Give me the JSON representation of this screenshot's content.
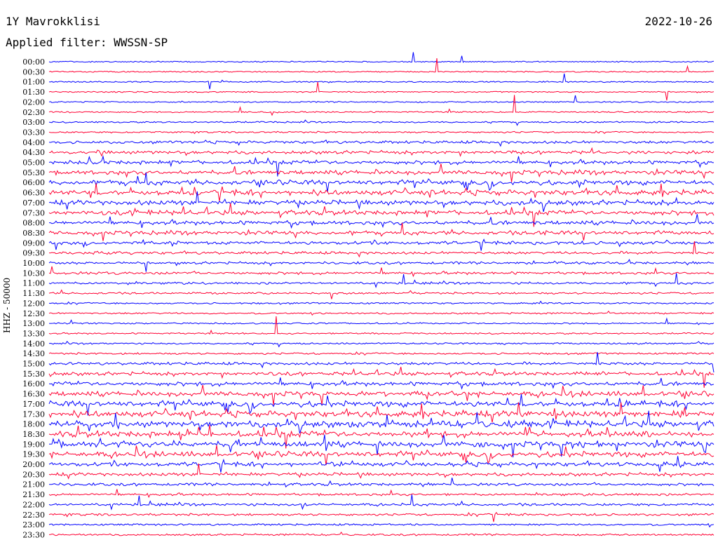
{
  "header": {
    "station": "1Y Mavrokklisi",
    "filter": "Applied filter: WWSSN-SP",
    "date": "2022-10-26"
  },
  "chart_data": {
    "type": "line",
    "title": "1Y Mavrokklisi",
    "subtitle": "Applied filter: WWSSN-SP",
    "date": "2022-10-26",
    "ylabel": "HHZ - 50000",
    "xlabel": "",
    "row_labels": [
      "00:00",
      "00:30",
      "01:00",
      "01:30",
      "02:00",
      "02:30",
      "03:00",
      "03:30",
      "04:00",
      "04:30",
      "05:00",
      "05:30",
      "06:00",
      "06:30",
      "07:00",
      "07:30",
      "08:00",
      "08:30",
      "09:00",
      "09:30",
      "10:00",
      "10:30",
      "11:00",
      "11:30",
      "12:00",
      "12:30",
      "13:00",
      "13:30",
      "14:00",
      "14:30",
      "15:00",
      "15:30",
      "16:00",
      "16:30",
      "17:00",
      "17:30",
      "18:00",
      "18:30",
      "19:00",
      "19:30",
      "20:00",
      "20:30",
      "21:00",
      "21:30",
      "22:00",
      "22:30",
      "23:00",
      "23:30"
    ],
    "row_colors": [
      "#0000ff",
      "#ff0033"
    ],
    "activity": [
      0.05,
      0.06,
      0.08,
      0.06,
      0.07,
      0.09,
      0.12,
      0.15,
      0.35,
      0.45,
      0.55,
      0.65,
      0.7,
      0.8,
      0.75,
      0.7,
      0.6,
      0.55,
      0.45,
      0.35,
      0.3,
      0.35,
      0.25,
      0.2,
      0.15,
      0.15,
      0.12,
      0.12,
      0.15,
      0.2,
      0.35,
      0.5,
      0.6,
      0.75,
      0.85,
      0.95,
      1.0,
      0.95,
      0.9,
      0.8,
      0.6,
      0.45,
      0.35,
      0.3,
      0.3,
      0.25,
      0.2,
      0.18
    ],
    "grid": false,
    "legend": "none"
  }
}
